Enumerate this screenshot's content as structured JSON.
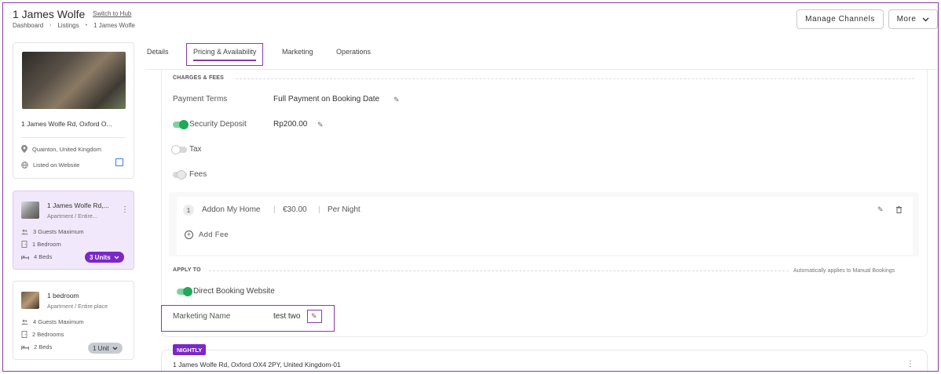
{
  "header": {
    "title": "1 James Wolfe",
    "switch_link": "Switch to Hub",
    "breadcrumb": [
      "Dashboard",
      "Listings",
      "1 James Wolfe"
    ],
    "manage_channels": "Manage Channels",
    "more": "More"
  },
  "sidebar": {
    "property": {
      "address": "1 James Wolfe Rd, Oxford O...",
      "location": "Quainton, United Kingdom",
      "listed": "Listed on Website"
    },
    "units": [
      {
        "title": "1 James Wolfe Rd,...",
        "subtitle": "Apartment / Entire...",
        "guests": "3 Guests Maximum",
        "bedrooms": "1 Bedroom",
        "beds": "4 Beds",
        "units_label": "3 Units"
      },
      {
        "title": "1 bedroom",
        "subtitle": "Apartment / Entire place",
        "guests": "4 Guests Maximum",
        "bedrooms": "2 Bedrooms",
        "beds": "2 Beds",
        "units_label": "1 Unit"
      }
    ]
  },
  "tabs": [
    "Details",
    "Pricing & Availability",
    "Marketing",
    "Operations"
  ],
  "charges": {
    "heading": "CHARGES & FEES",
    "payment_terms_label": "Payment Terms",
    "payment_terms_value": "Full Payment on Booking Date",
    "security_deposit_label": "Security Deposit",
    "security_deposit_value": "Rp200.00",
    "tax_label": "Tax",
    "fees_label": "Fees",
    "fee_item": {
      "index": "1",
      "name": "Addon My Home",
      "amount": "€30.00",
      "period": "Per Night"
    },
    "add_fee": "Add Fee"
  },
  "apply_to": {
    "heading": "APPLY TO",
    "note": "Automatically applies to Manual Bookings",
    "channel": "Direct Booking Website",
    "marketing_name_label": "Marketing Name",
    "marketing_name_value": "test two"
  },
  "nightly": {
    "badge": "NIGHTLY",
    "address": "1 James Wolfe Rd, Oxford OX4 2PY, United Kingdom-01"
  },
  "colors": {
    "accent": "#7b27c9",
    "toggle_on": "#21a957",
    "link": "#3b7ddd"
  }
}
